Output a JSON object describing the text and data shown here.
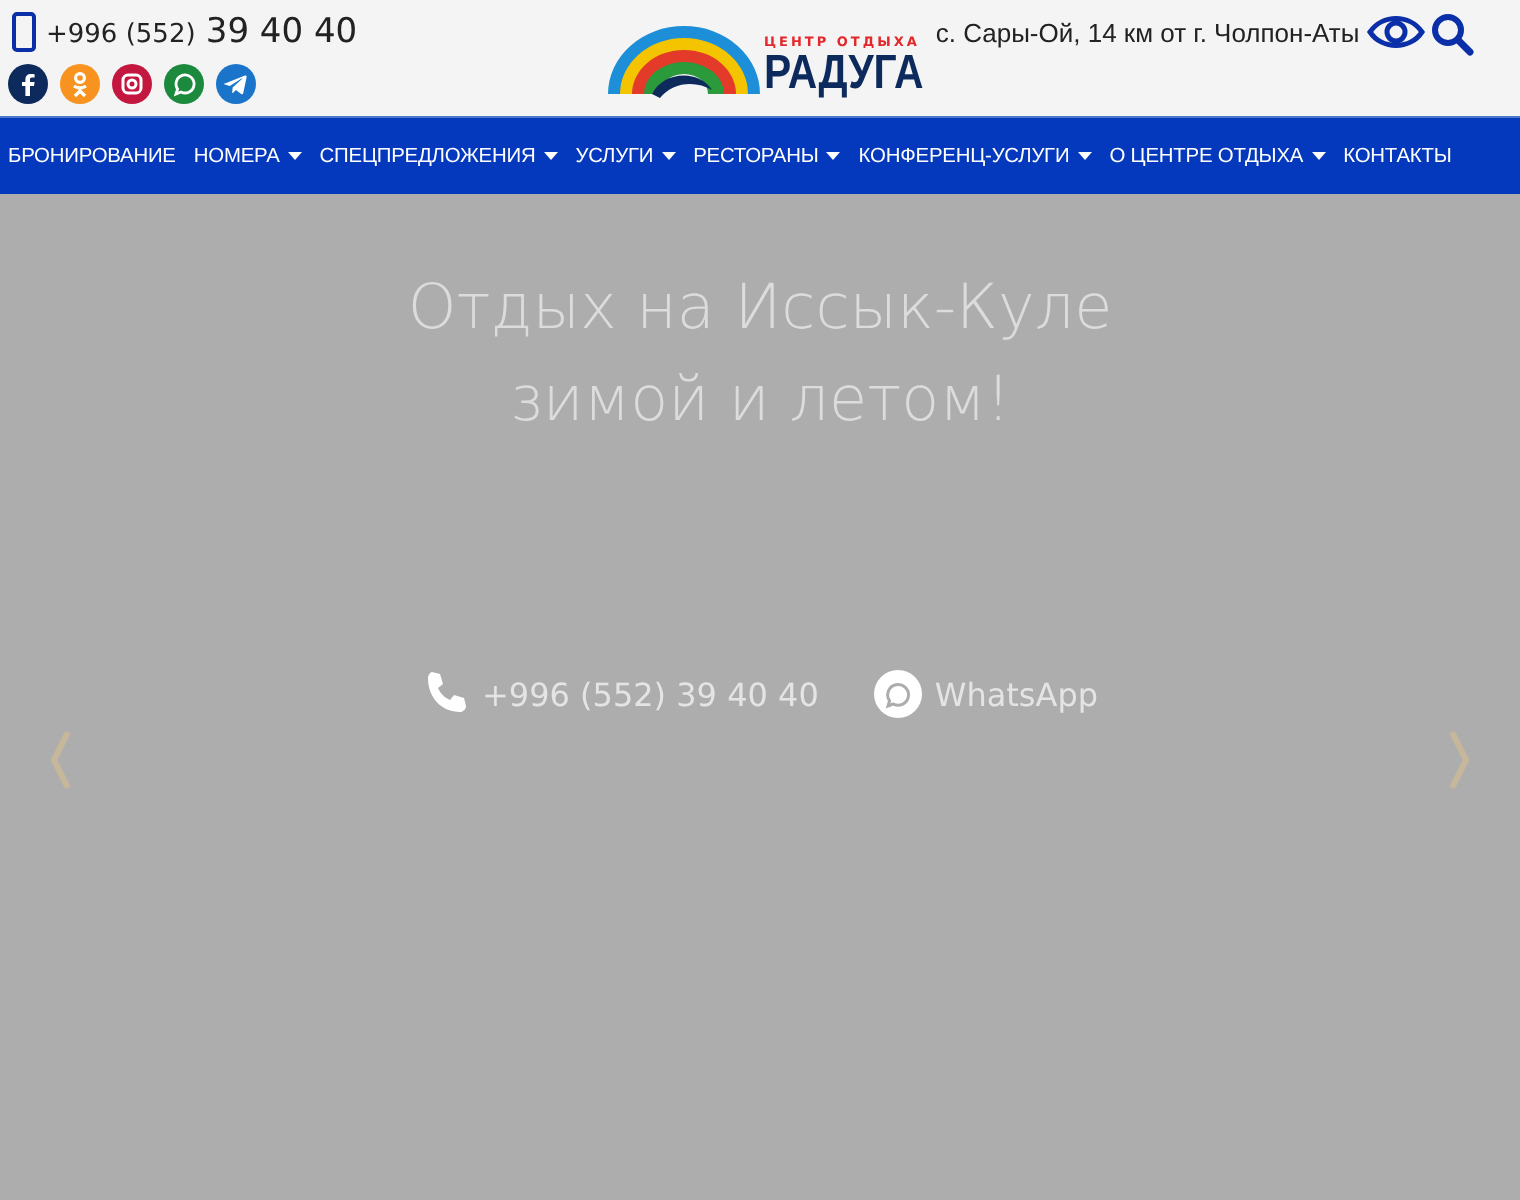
{
  "header": {
    "phone": {
      "prefix": "+996 (552)",
      "number": "39 40 40"
    },
    "socials": [
      {
        "kind": "facebook",
        "color": "#0d2a5c"
      },
      {
        "kind": "odnoklassniki",
        "color": "#f7931e"
      },
      {
        "kind": "instagram",
        "color": "#c4173f"
      },
      {
        "kind": "whatsapp",
        "color": "#1b8a3c"
      },
      {
        "kind": "telegram",
        "color": "#1a74c9"
      }
    ],
    "logo": {
      "tagline": "ЦЕНТР ОТДЫХА",
      "name": "РАДУГА"
    },
    "address": "с. Сары-Ой, 14 км от г. Чолпон-Аты"
  },
  "nav": [
    {
      "label": "БРОНИРОВАНИЕ",
      "has_dropdown": false
    },
    {
      "label": "НОМЕРА",
      "has_dropdown": true
    },
    {
      "label": "СПЕЦПРЕДЛОЖЕНИЯ",
      "has_dropdown": true
    },
    {
      "label": "УСЛУГИ",
      "has_dropdown": true
    },
    {
      "label": "РЕСТОРАНЫ",
      "has_dropdown": true
    },
    {
      "label": "КОНФЕРЕНЦ-УСЛУГИ",
      "has_dropdown": true
    },
    {
      "label": "О ЦЕНТРЕ ОТДЫХА",
      "has_dropdown": true
    },
    {
      "label": "КОНТАКТЫ",
      "has_dropdown": false
    }
  ],
  "hero": {
    "title": [
      "Отдых на Иссык-Куле",
      "зимой и летом!"
    ],
    "contacts": [
      {
        "kind": "phone",
        "label": "+996 (552) 39 40 40"
      },
      {
        "kind": "whatsapp",
        "label": "WhatsApp"
      }
    ]
  }
}
